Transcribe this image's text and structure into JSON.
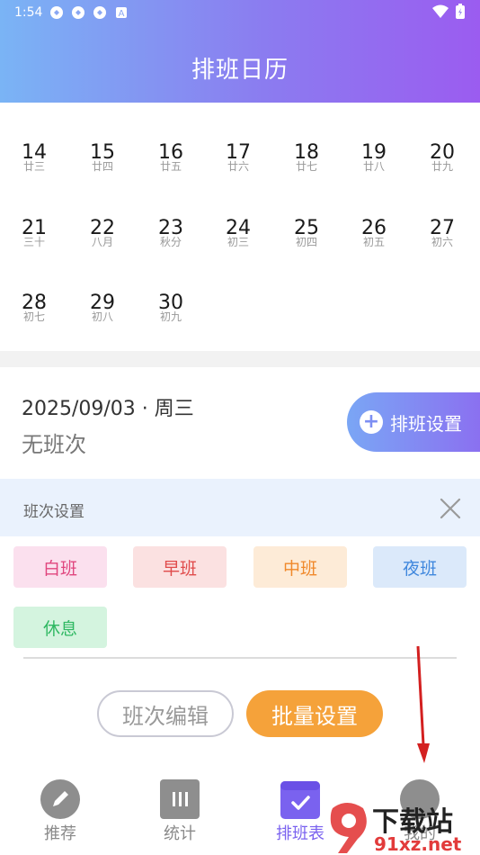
{
  "status_bar": {
    "time": "1:54"
  },
  "header": {
    "title": "排班日历"
  },
  "calendar": {
    "rows": [
      [
        {
          "day": "14",
          "lunar": "廿三"
        },
        {
          "day": "15",
          "lunar": "廿四"
        },
        {
          "day": "16",
          "lunar": "廿五"
        },
        {
          "day": "17",
          "lunar": "廿六"
        },
        {
          "day": "18",
          "lunar": "廿七"
        },
        {
          "day": "19",
          "lunar": "廿八"
        },
        {
          "day": "20",
          "lunar": "廿九"
        }
      ],
      [
        {
          "day": "21",
          "lunar": "三十"
        },
        {
          "day": "22",
          "lunar": "八月"
        },
        {
          "day": "23",
          "lunar": "秋分"
        },
        {
          "day": "24",
          "lunar": "初三"
        },
        {
          "day": "25",
          "lunar": "初四"
        },
        {
          "day": "26",
          "lunar": "初五"
        },
        {
          "day": "27",
          "lunar": "初六"
        }
      ],
      [
        {
          "day": "28",
          "lunar": "初七"
        },
        {
          "day": "29",
          "lunar": "初八"
        },
        {
          "day": "30",
          "lunar": "初九"
        }
      ]
    ]
  },
  "selected": {
    "date": "2025/09/03 · 周三",
    "shift_status": "无班次",
    "schedule_button": "排班设置"
  },
  "shift_settings": {
    "label": "班次设置",
    "chips": [
      {
        "label": "白班",
        "bg": "#fbe0ee",
        "fg": "#e0457e"
      },
      {
        "label": "早班",
        "bg": "#fbe1e1",
        "fg": "#e04b4b"
      },
      {
        "label": "中班",
        "bg": "#fdebd7",
        "fg": "#f0882a"
      },
      {
        "label": "夜班",
        "bg": "#dbe9fa",
        "fg": "#3f87dd"
      },
      {
        "label": "休息",
        "bg": "#d4f4df",
        "fg": "#2fb862"
      }
    ]
  },
  "actions": {
    "edit": "班次编辑",
    "batch": "批量设置"
  },
  "tabs": [
    {
      "label": "推荐",
      "icon": "pencil-icon"
    },
    {
      "label": "统计",
      "icon": "stats-icon"
    },
    {
      "label": "排班表",
      "icon": "calendar-check-icon"
    },
    {
      "label": "我的",
      "icon": "user-icon"
    }
  ],
  "watermark": {
    "brand": "下载站",
    "site": "91xz.net"
  },
  "colors": {
    "accent": "#7a62ef",
    "batch": "#f5a23a"
  }
}
